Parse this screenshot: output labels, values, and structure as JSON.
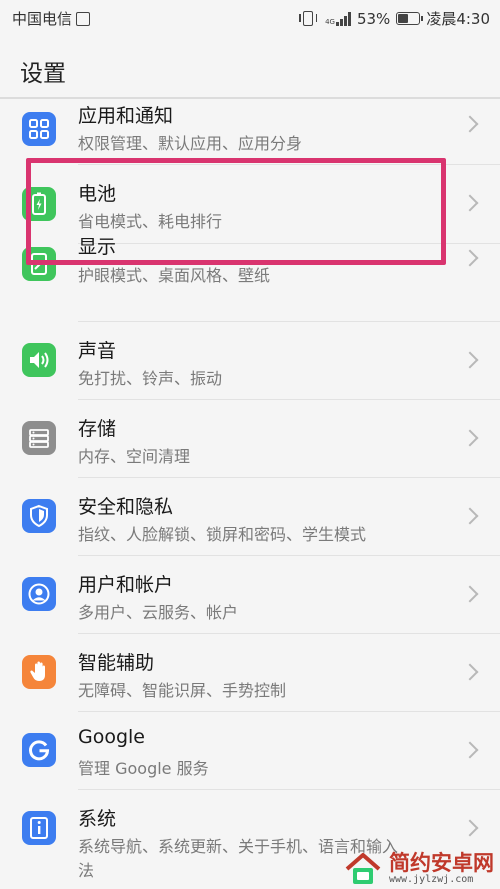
{
  "status_bar": {
    "carrier": "中国电信",
    "net_type": "4G",
    "battery_percent": "53%",
    "battery_level": 0.53,
    "time": "凌晨4:30"
  },
  "header": {
    "title": "设置"
  },
  "items": [
    {
      "id": "apps",
      "title": "应用和通知",
      "subtitle": "权限管理、默认应用、应用分身",
      "icon": "apps-grid-icon",
      "color": "#3d7df0"
    },
    {
      "id": "battery",
      "title": "电池",
      "subtitle": "省电模式、耗电排行",
      "icon": "battery-icon",
      "color": "#3fc55c"
    },
    {
      "id": "display",
      "title": "显示",
      "subtitle": "护眼模式、桌面风格、壁纸",
      "icon": "display-icon",
      "color": "#3fc55c"
    },
    {
      "id": "sound",
      "title": "声音",
      "subtitle": "免打扰、铃声、振动",
      "icon": "speaker-icon",
      "color": "#3fc55c"
    },
    {
      "id": "storage",
      "title": "存储",
      "subtitle": "内存、空间清理",
      "icon": "storage-icon",
      "color": "#8e8e8e"
    },
    {
      "id": "security",
      "title": "安全和隐私",
      "subtitle": "指纹、人脸解锁、锁屏和密码、学生模式",
      "icon": "shield-icon",
      "color": "#3d7df0"
    },
    {
      "id": "accounts",
      "title": "用户和帐户",
      "subtitle": "多用户、云服务、帐户",
      "icon": "user-icon",
      "color": "#3d7df0"
    },
    {
      "id": "assist",
      "title": "智能辅助",
      "subtitle": "无障碍、智能识屏、手势控制",
      "icon": "hand-icon",
      "color": "#f5853a"
    },
    {
      "id": "google",
      "title": "Google",
      "subtitle": "管理 Google 服务",
      "icon": "google-g-icon",
      "color": "#3d7df0"
    },
    {
      "id": "system",
      "title": "系统",
      "subtitle": "系统导航、系统更新、关于手机、语言和输入",
      "subtitle_wrap": "法",
      "icon": "info-icon",
      "color": "#3d7df0"
    }
  ],
  "watermark": {
    "main": "简约安卓网",
    "sub": "www.jylzwj.com"
  }
}
